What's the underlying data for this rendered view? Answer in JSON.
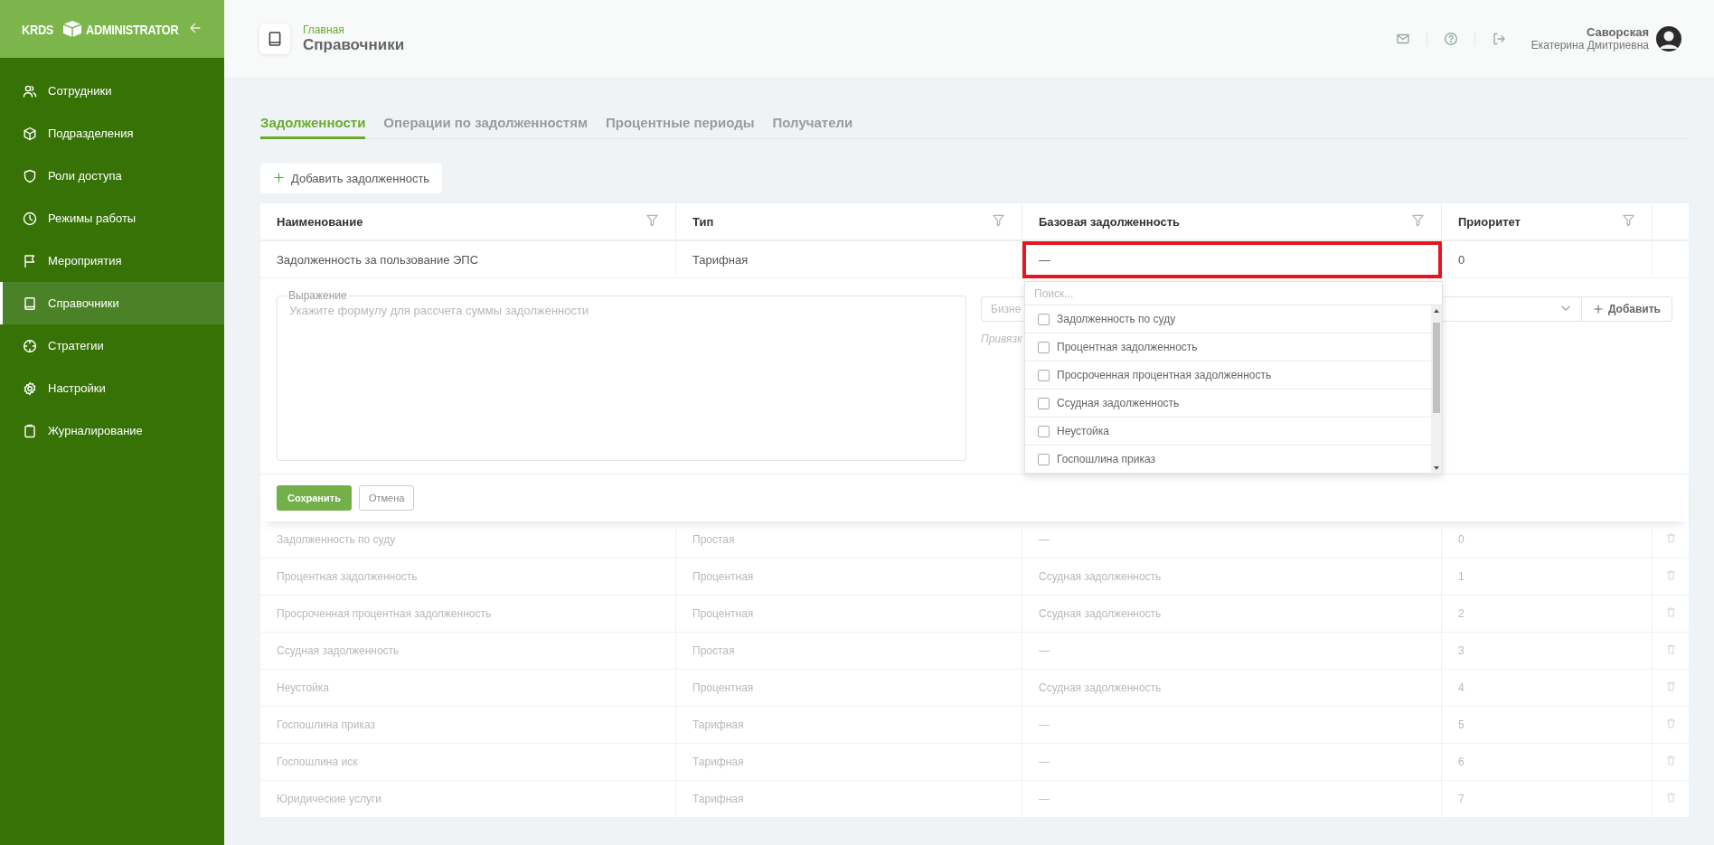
{
  "sidebar": {
    "logo_left": "KRDS",
    "logo_right": "ADMINISTRATOR",
    "items": [
      {
        "label": "Сотрудники",
        "selected": false
      },
      {
        "label": "Подразделения",
        "selected": false
      },
      {
        "label": "Роли доступа",
        "selected": false
      },
      {
        "label": "Режимы работы",
        "selected": false
      },
      {
        "label": "Мероприятия",
        "selected": false
      },
      {
        "label": "Справочники",
        "selected": true
      },
      {
        "label": "Стратегии",
        "selected": false
      },
      {
        "label": "Настройки",
        "selected": false
      },
      {
        "label": "Журналирование",
        "selected": false
      }
    ]
  },
  "header": {
    "breadcrumb": "Главная",
    "title": "Справочники",
    "user": {
      "surname": "Саворская",
      "name": "Екатерина Дмитриевна"
    }
  },
  "tabs": [
    {
      "label": "Задолженности",
      "selected": true
    },
    {
      "label": "Операции по задолженностям",
      "selected": false
    },
    {
      "label": "Процентные периоды",
      "selected": false
    },
    {
      "label": "Получатели",
      "selected": false
    }
  ],
  "add_button": "Добавить задолженность",
  "table": {
    "columns": [
      "Наименование",
      "Тип",
      "Базовая задолженность",
      "Приоритет"
    ],
    "editing_row": {
      "name": "Задолженность за пользование ЭПС",
      "type": "Тарифная",
      "base": "—",
      "priority": "0",
      "highlighted": true
    },
    "editor": {
      "expression_label": "Выражение",
      "expression_placeholder": "Укажите формулу для рассчета суммы задолженности",
      "select_placeholder": "Бизне",
      "add_button": "Добавить",
      "hint": "Привязк",
      "save_button": "Сохранить",
      "cancel_button": "Отмена"
    },
    "dropdown": {
      "search_placeholder": "Поиск...",
      "options": [
        {
          "label": "Задолженность по суду",
          "checked": false
        },
        {
          "label": "Процентная задолженность",
          "checked": false
        },
        {
          "label": "Просроченная процентная задолженность",
          "checked": false
        },
        {
          "label": "Ссудная задолженность",
          "checked": false
        },
        {
          "label": "Неустойка",
          "checked": false
        },
        {
          "label": "Госпошлина приказ",
          "checked": false
        }
      ]
    },
    "rows": [
      {
        "name": "Задолженность по суду",
        "type": "Простая",
        "base": "—",
        "priority": "0"
      },
      {
        "name": "Процентная задолженность",
        "type": "Процентная",
        "base": "Ссудная задолженность",
        "priority": "1"
      },
      {
        "name": "Просроченная процентная задолженность",
        "type": "Процентная",
        "base": "Ссудная задолженность",
        "priority": "2"
      },
      {
        "name": "Ссудная задолженность",
        "type": "Простая",
        "base": "—",
        "priority": "3"
      },
      {
        "name": "Неустойка",
        "type": "Процентная",
        "base": "Ссудная задолженность",
        "priority": "4"
      },
      {
        "name": "Госпошлина приказ",
        "type": "Тарифная",
        "base": "—",
        "priority": "5"
      },
      {
        "name": "Госпошлина иск",
        "type": "Тарифная",
        "base": "—",
        "priority": "6"
      },
      {
        "name": "Юридические услуги",
        "type": "Тарифная",
        "base": "—",
        "priority": "7"
      }
    ]
  }
}
